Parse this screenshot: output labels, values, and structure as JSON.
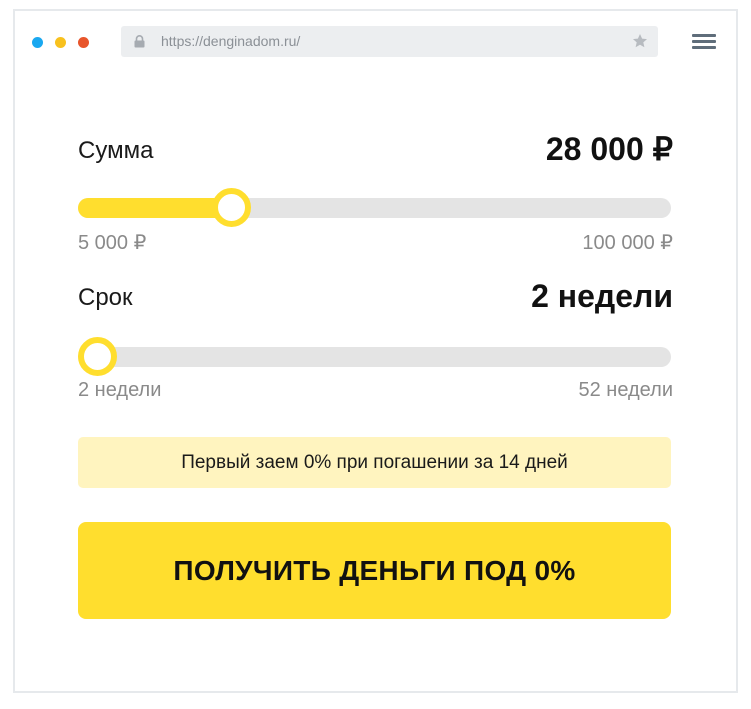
{
  "browser": {
    "url": "https://denginadom.ru/",
    "icons": [
      "lock-icon",
      "star-icon",
      "menu-icon"
    ]
  },
  "colors": {
    "accent": "#ffde2e",
    "track": "#e4e4e4",
    "promo_bg": "#fff4bf",
    "dot_blue": "#1aa8f0",
    "dot_yellow": "#f8c11e",
    "dot_red": "#e8552b"
  },
  "amount": {
    "label": "Сумма",
    "value": "28 000 ₽",
    "min_label": "5 000 ₽",
    "max_label": "100 000 ₽",
    "min": 5000,
    "max": 100000,
    "current": 28000
  },
  "term": {
    "label": "Срок",
    "value": "2 недели",
    "min_label": "2 недели",
    "max_label": "52 недели",
    "min": 2,
    "max": 52,
    "current": 2
  },
  "promo": {
    "text": "Первый заем 0% при погашении за 14 дней"
  },
  "cta": {
    "label": "ПОЛУЧИТЬ ДЕНЬГИ ПОД 0%"
  }
}
